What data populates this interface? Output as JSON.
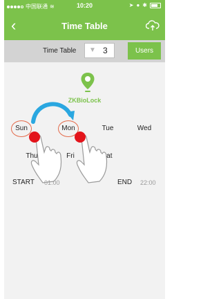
{
  "status": {
    "carrier": "中国联通",
    "time": "10:20"
  },
  "nav": {
    "title": "Time Table"
  },
  "toolbar": {
    "label": "Time Table",
    "value": "3",
    "users_label": "Users"
  },
  "lock": {
    "name": "ZKBioLock"
  },
  "days": [
    {
      "key": "sun",
      "label": "Sun",
      "selected": true
    },
    {
      "key": "mon",
      "label": "Mon",
      "selected": true
    },
    {
      "key": "tue",
      "label": "Tue",
      "selected": false
    },
    {
      "key": "wed",
      "label": "Wed",
      "selected": false
    },
    {
      "key": "thu",
      "label": "Thu",
      "selected": false
    },
    {
      "key": "fri",
      "label": "Fri",
      "selected": false
    },
    {
      "key": "sat",
      "label": "Sat",
      "selected": false
    }
  ],
  "times": {
    "start_label": "START",
    "start_value": "01:00",
    "end_label": "END",
    "end_value": "22:00"
  },
  "colors": {
    "brand": "#7cc24b",
    "toolbar": "#d3d3d3",
    "select_ring": "#e36a4a",
    "touch_dot": "#e3141b",
    "arrow": "#2aa7e0"
  }
}
